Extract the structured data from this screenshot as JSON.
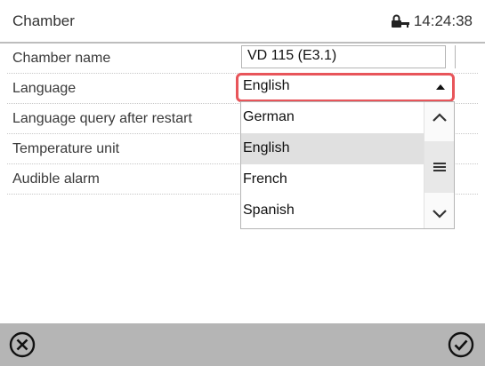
{
  "header": {
    "title": "Chamber",
    "time": "14:24:38",
    "status_icon": "lock-icon"
  },
  "settings": {
    "chamber_name": {
      "label": "Chamber name",
      "value": "VD 115 (E3.1)"
    },
    "language": {
      "label": "Language",
      "value": "English"
    },
    "language_query": {
      "label": "Language query after restart"
    },
    "temperature_unit": {
      "label": "Temperature unit"
    },
    "audible_alarm": {
      "label": "Audible alarm"
    }
  },
  "dropdown": {
    "options": [
      "German",
      "English",
      "French",
      "Spanish"
    ],
    "selected": "English"
  },
  "footer": {
    "cancel_icon": "cancel-circle-icon",
    "confirm_icon": "confirm-check-icon"
  },
  "colors": {
    "highlight": "#e8555a",
    "footer_bg": "#b5b5b5",
    "selected_bg": "#e0e0e0"
  }
}
